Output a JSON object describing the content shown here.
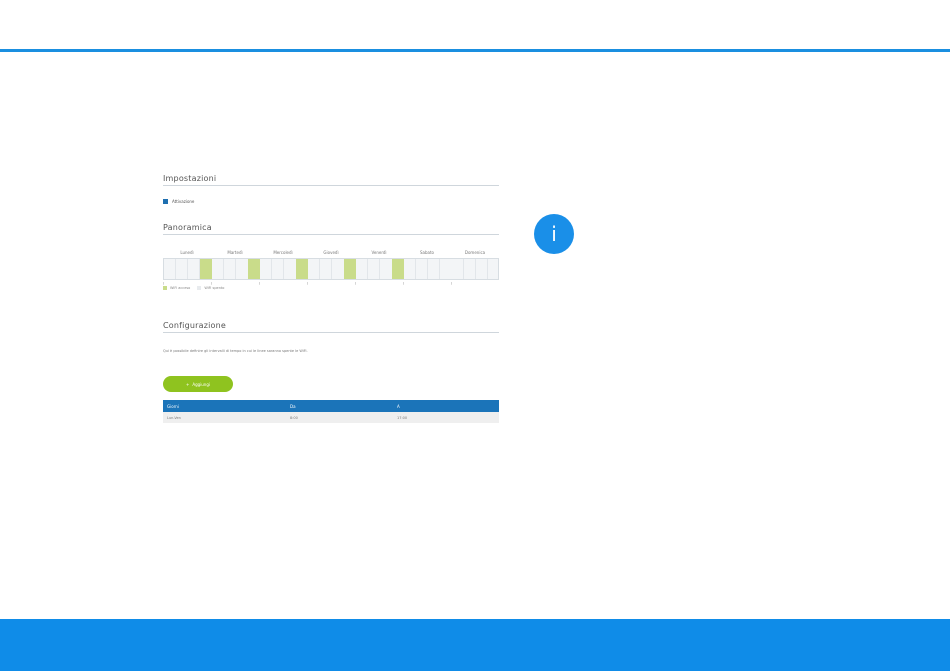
{
  "panel": {
    "impostazioni": {
      "title": "Impostazioni",
      "checkbox_label": "Attivazione"
    },
    "panoramica": {
      "title": "Panoramica",
      "days": [
        "Lunedì",
        "Martedì",
        "Mercoledì",
        "Giovedì",
        "Venerdì",
        "Sabato",
        "Domenica"
      ],
      "legend_on": "WiFi acceso",
      "legend_off": "WiFi spento"
    },
    "configurazione": {
      "title": "Configurazione",
      "description": "Qui è possibile definire gli intervalli di tempo in cui le linee saranno spente le WiFi.",
      "add_button": "Aggiungi",
      "table": {
        "headers": [
          "Giorni",
          "Da",
          "A"
        ],
        "rows": [
          [
            "Lun-Ven",
            "8:00",
            "17:00"
          ]
        ]
      }
    }
  },
  "colors": {
    "accent": "#1a8fe0",
    "active": "#c9dc8a",
    "button": "#8fc31f",
    "table_header": "#1b74b9"
  },
  "icons": {
    "info": "info-icon",
    "plus": "plus-icon"
  },
  "info_glyph": "i"
}
